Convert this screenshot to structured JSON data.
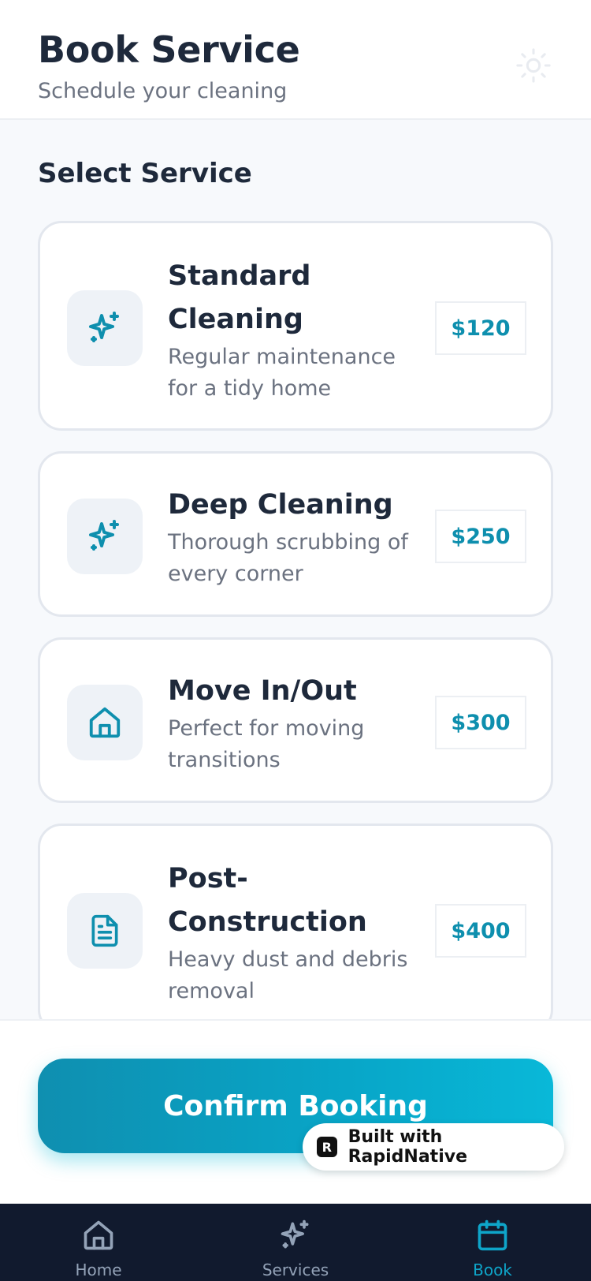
{
  "header": {
    "title": "Book Service",
    "subtitle": "Schedule your cleaning",
    "theme_icon": "sun-icon"
  },
  "section": {
    "title": "Select Service"
  },
  "services": [
    {
      "name": "Standard Cleaning",
      "description": "Regular maintenance for a tidy home",
      "price": "$120",
      "icon": "sparkles-icon"
    },
    {
      "name": "Deep Cleaning",
      "description": "Thorough scrubbing of every corner",
      "price": "$250",
      "icon": "sparkles-icon"
    },
    {
      "name": "Move In/Out",
      "description": "Perfect for moving transitions",
      "price": "$300",
      "icon": "home-icon"
    },
    {
      "name": "Post-Construction",
      "description": "Heavy dust and debris removal",
      "price": "$400",
      "icon": "document-icon"
    }
  ],
  "actions": {
    "confirm_label": "Confirm Booking"
  },
  "badge": {
    "logo_letter": "R",
    "text": "Built with RapidNative"
  },
  "tabs": [
    {
      "label": "Home",
      "icon": "home-icon",
      "active": false
    },
    {
      "label": "Services",
      "icon": "sparkles-icon",
      "active": false
    },
    {
      "label": "Book",
      "icon": "calendar-icon",
      "active": true
    }
  ],
  "colors": {
    "accent": "#0e8fae",
    "tabbar": "#111a2e",
    "active_tab": "#0ea5c9"
  }
}
